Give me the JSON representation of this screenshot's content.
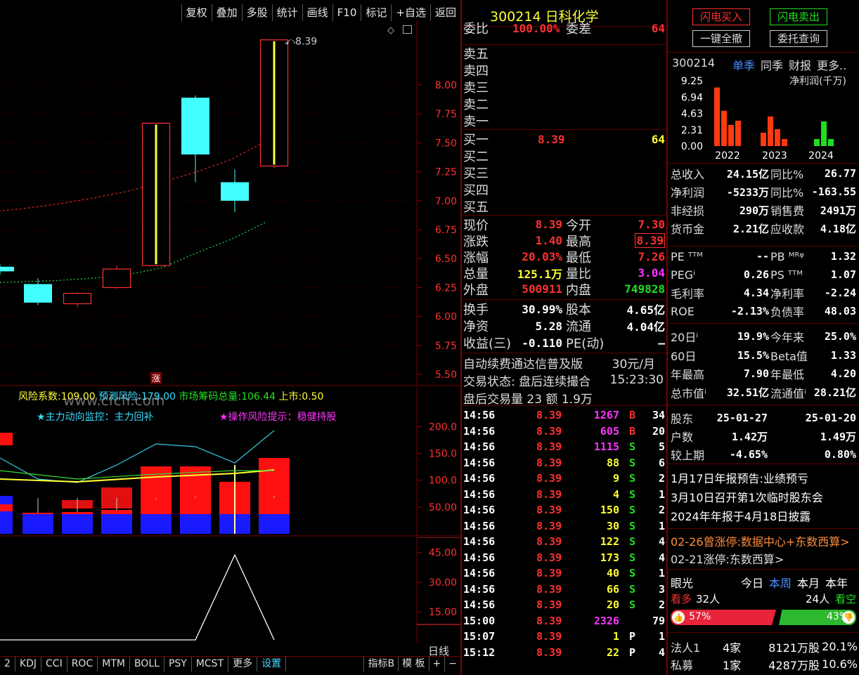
{
  "toolbar": [
    "复权",
    "叠加",
    "多股",
    "统计",
    "画线",
    "F10",
    "标记",
    "+自选",
    "返回"
  ],
  "chart": {
    "y_labels": [
      "8.00",
      "7.75",
      "7.50",
      "7.25",
      "7.00",
      "6.75",
      "6.50",
      "6.25",
      "6.00",
      "5.75",
      "5.50"
    ],
    "y_values": [
      8.0,
      7.75,
      7.5,
      7.25,
      7.0,
      6.75,
      6.5,
      6.25,
      6.0,
      5.75,
      5.5
    ],
    "high_label": "8.39",
    "zhang_marker": "涨",
    "candles": [
      {
        "o": 6.39,
        "c": 6.43,
        "h": 6.45,
        "l": 6.36,
        "color": "cyan"
      },
      {
        "o": 6.28,
        "c": 6.12,
        "h": 6.33,
        "l": 6.1,
        "color": "cyan"
      },
      {
        "o": 6.11,
        "c": 6.2,
        "h": 6.21,
        "l": 6.08,
        "color": "red"
      },
      {
        "o": 6.25,
        "c": 6.41,
        "h": 6.44,
        "l": 6.24,
        "color": "red"
      },
      {
        "o": 6.44,
        "c": 7.67,
        "h": 7.67,
        "l": 6.44,
        "color": "red"
      },
      {
        "o": 7.4,
        "c": 7.89,
        "h": 7.91,
        "l": 7.16,
        "color": "cyan"
      },
      {
        "o": 7.16,
        "c": 7.0,
        "h": 7.27,
        "l": 6.9,
        "color": "cyan"
      },
      {
        "o": 7.3,
        "c": 8.39,
        "h": 8.39,
        "l": 7.28,
        "color": "red"
      }
    ],
    "ma_red": [
      6.9,
      6.93,
      6.97,
      7.02,
      7.08,
      7.16,
      7.25,
      7.36,
      7.52
    ],
    "ma_green": [
      6.29,
      6.3,
      6.31,
      6.33,
      6.36,
      6.42,
      6.55,
      6.67,
      6.82
    ]
  },
  "ind1": {
    "risk_label": "风险系数:",
    "risk_val": "109.00",
    "predict_label": "预测风险:",
    "predict_val": "179.00",
    "chip_label": "市场筹码总量:",
    "chip_val": "106.44",
    "listing_label": "上市:",
    "listing_val": "0.50",
    "watermark": "www.cfcfi.com",
    "monitor": "★主力动向监控：主力回补",
    "hint": "★操作风险提示：稳健持股",
    "y_labels": [
      "200.0",
      "150.0",
      "100.0",
      "50.00"
    ],
    "y_values": [
      200,
      150,
      100,
      50
    ]
  },
  "ind2": {
    "y_labels": [
      "45.00",
      "30.00",
      "15.00"
    ],
    "y_values": [
      45,
      30,
      15
    ]
  },
  "bottom_tabs": [
    "2",
    "KDJ",
    "CCI",
    "ROC",
    "MTM",
    "BOLL",
    "PSY",
    "MCST",
    "更多",
    "设置"
  ],
  "bottom_right": [
    "指标B",
    "模 板",
    "+",
    "−"
  ],
  "period": "日线",
  "quote": {
    "code": "300214",
    "name": "日科化学",
    "wb_label": "委比",
    "wb_val": "100.00%",
    "wc_label": "委差",
    "wc_val": "64",
    "sells": [
      "卖五",
      "卖四",
      "卖三",
      "卖二",
      "卖一"
    ],
    "buys": [
      {
        "l": "买一",
        "p": "8.39",
        "v": "64"
      },
      {
        "l": "买二",
        "p": "",
        "v": ""
      },
      {
        "l": "买三",
        "p": "",
        "v": ""
      },
      {
        "l": "买四",
        "p": "",
        "v": ""
      },
      {
        "l": "买五",
        "p": "",
        "v": ""
      }
    ],
    "stats": [
      {
        "l1": "现价",
        "v1": "8.39",
        "c1": "red",
        "l2": "今开",
        "v2": "7.30",
        "c2": "red"
      },
      {
        "l1": "涨跌",
        "v1": "1.40",
        "c1": "red",
        "l2": "最高",
        "v2": "8.39",
        "c2": "red"
      },
      {
        "l1": "涨幅",
        "v1": "20.03%",
        "c1": "red",
        "l2": "最低",
        "v2": "7.26",
        "c2": "red"
      },
      {
        "l1": "总量",
        "v1": "125.1万",
        "c1": "yel",
        "l2": "量比",
        "v2": "3.04",
        "c2": "mag"
      },
      {
        "l1": "外盘",
        "v1": "500911",
        "c1": "red",
        "l2": "内盘",
        "v2": "749828",
        "c2": "grn"
      }
    ],
    "stats2": [
      {
        "l1": "换手",
        "v1": "30.99%",
        "l2": "股本",
        "v2": "4.65亿"
      },
      {
        "l1": "净资",
        "v1": "5.28",
        "l2": "流通",
        "v2": "4.04亿"
      },
      {
        "l1": "收益(三)",
        "v1": "-0.110",
        "l2": "PE(动)",
        "v2": "–"
      }
    ],
    "fee_text": "自动续费通达信普及版",
    "fee_price": "30元/月",
    "trade_status": "交易状态: 盘后连续撮合",
    "trade_time": "15:23:30",
    "after_vol": "盘后交易量 23 额 1.9万"
  },
  "ticks": [
    [
      "14:56",
      "8.39",
      "1267",
      "B",
      "34",
      "mag"
    ],
    [
      "14:56",
      "8.39",
      "605",
      "B",
      "20",
      "mag"
    ],
    [
      "14:56",
      "8.39",
      "1115",
      "S",
      "5",
      "mag"
    ],
    [
      "14:56",
      "8.39",
      "88",
      "S",
      "6",
      "yel"
    ],
    [
      "14:56",
      "8.39",
      "9",
      "S",
      "2",
      "yel"
    ],
    [
      "14:56",
      "8.39",
      "4",
      "S",
      "1",
      "yel"
    ],
    [
      "14:56",
      "8.39",
      "150",
      "S",
      "2",
      "yel"
    ],
    [
      "14:56",
      "8.39",
      "30",
      "S",
      "1",
      "yel"
    ],
    [
      "14:56",
      "8.39",
      "122",
      "S",
      "4",
      "yel"
    ],
    [
      "14:56",
      "8.39",
      "173",
      "S",
      "4",
      "yel"
    ],
    [
      "14:56",
      "8.39",
      "40",
      "S",
      "1",
      "yel"
    ],
    [
      "14:56",
      "8.39",
      "66",
      "S",
      "3",
      "yel"
    ],
    [
      "14:56",
      "8.39",
      "20",
      "S",
      "2",
      "yel"
    ],
    [
      "15:00",
      "8.39",
      "2326",
      "",
      "79",
      "mag"
    ],
    [
      "15:07",
      "8.39",
      "1",
      "P",
      "1",
      "yel"
    ],
    [
      "15:12",
      "8.39",
      "22",
      "P",
      "4",
      "yel"
    ]
  ],
  "right": {
    "btn_buy": "闪电买入",
    "btn_sell": "闪电卖出",
    "btn_cancel": "一键全撤",
    "btn_query": "委托查询",
    "code": "300214",
    "tabs": [
      "单季",
      "同季",
      "财报",
      "更多.."
    ],
    "fin_y": [
      "9.25",
      "6.94",
      "4.63",
      "2.31",
      "0.00"
    ],
    "fin_title": "净利润(千万)",
    "years": [
      "2022",
      "2023",
      "2024"
    ],
    "fin_bars": [
      {
        "v": 8.3,
        "c": "red"
      },
      {
        "v": 5.0,
        "c": "red"
      },
      {
        "v": 3.0,
        "c": "red"
      },
      {
        "v": 3.6,
        "c": "red"
      },
      {
        "v": 1.9,
        "c": "red"
      },
      {
        "v": 4.2,
        "c": "red"
      },
      {
        "v": 2.4,
        "c": "red"
      },
      {
        "v": 1.0,
        "c": "red"
      },
      {
        "v": 1.0,
        "c": "grn"
      },
      {
        "v": 3.5,
        "c": "grn"
      },
      {
        "v": 1.0,
        "c": "grn"
      }
    ],
    "fin_rows": [
      {
        "l1": "总收入",
        "v1": "24.15亿",
        "l2": "同比%",
        "v2": "26.77"
      },
      {
        "l1": "净利润",
        "v1": "-5233万",
        "l2": "同比%",
        "v2": "-163.55"
      },
      {
        "l1": "非经损",
        "v1": "290万",
        "l2": "销售费",
        "v2": "2491万"
      },
      {
        "l1": "货币金",
        "v1": "2.21亿",
        "l2": "应收款",
        "v2": "4.18亿"
      }
    ],
    "val_rows": [
      {
        "l1": "PE ᵀᵀᴹ",
        "v1": "--",
        "l2": "PB ᴹᴿᵠ",
        "v2": "1.32"
      },
      {
        "l1": "PEGⁱ",
        "v1": "0.26",
        "l2": "PS ᵀᵀᴹ",
        "v2": "1.07"
      },
      {
        "l1": "毛利率",
        "v1": "4.34",
        "l2": "净利率",
        "v2": "-2.24"
      },
      {
        "l1": "ROE",
        "v1": "-2.13%",
        "l2": "负债率",
        "v2": "48.03"
      }
    ],
    "perf_rows": [
      {
        "l1": "20日ⁱ",
        "v1": "19.9%",
        "l2": "今年来",
        "v2": "25.0%"
      },
      {
        "l1": "60日",
        "v1": "15.5%",
        "l2": "Beta值",
        "v2": "1.33"
      },
      {
        "l1": "年最高",
        "v1": "7.90",
        "l2": "年最低",
        "v2": "4.20"
      },
      {
        "l1": "总市值ⁱ",
        "v1": "32.51亿",
        "l2": "流通值ⁱ",
        "v2": "28.21亿"
      }
    ],
    "holders": {
      "label": "股东",
      "d1": "25-01-27",
      "d2": "25-01-20",
      "count_label": "户数",
      "c1": "1.42万",
      "c2": "1.49万",
      "cmp_label": "较上期",
      "p1": "-4.65%",
      "p2": "0.80%"
    },
    "news": [
      "1月17日年报预告:业绩预亏",
      "3月10日召开第1次临时股东会",
      "2024年年报于4月18日披露"
    ],
    "limit1": "02-26曾涨停:数据中心+东数西算>",
    "limit2": "02-21涨停:东数西算>",
    "eye": {
      "label": "眼光",
      "tabs": [
        "今日",
        "本周",
        "本月",
        "本年"
      ],
      "bull": "看多",
      "bull_n": "32人",
      "bear_n": "24人",
      "bear": "看空",
      "bull_pct": "57%",
      "bear_pct": "43%"
    },
    "inst": [
      {
        "l": "法人1",
        "n": "4家",
        "s": "8121万股",
        "p": "20.1%"
      },
      {
        "l": "私募",
        "n": "1家",
        "s": "4287万股",
        "p": "10.6%"
      }
    ]
  }
}
